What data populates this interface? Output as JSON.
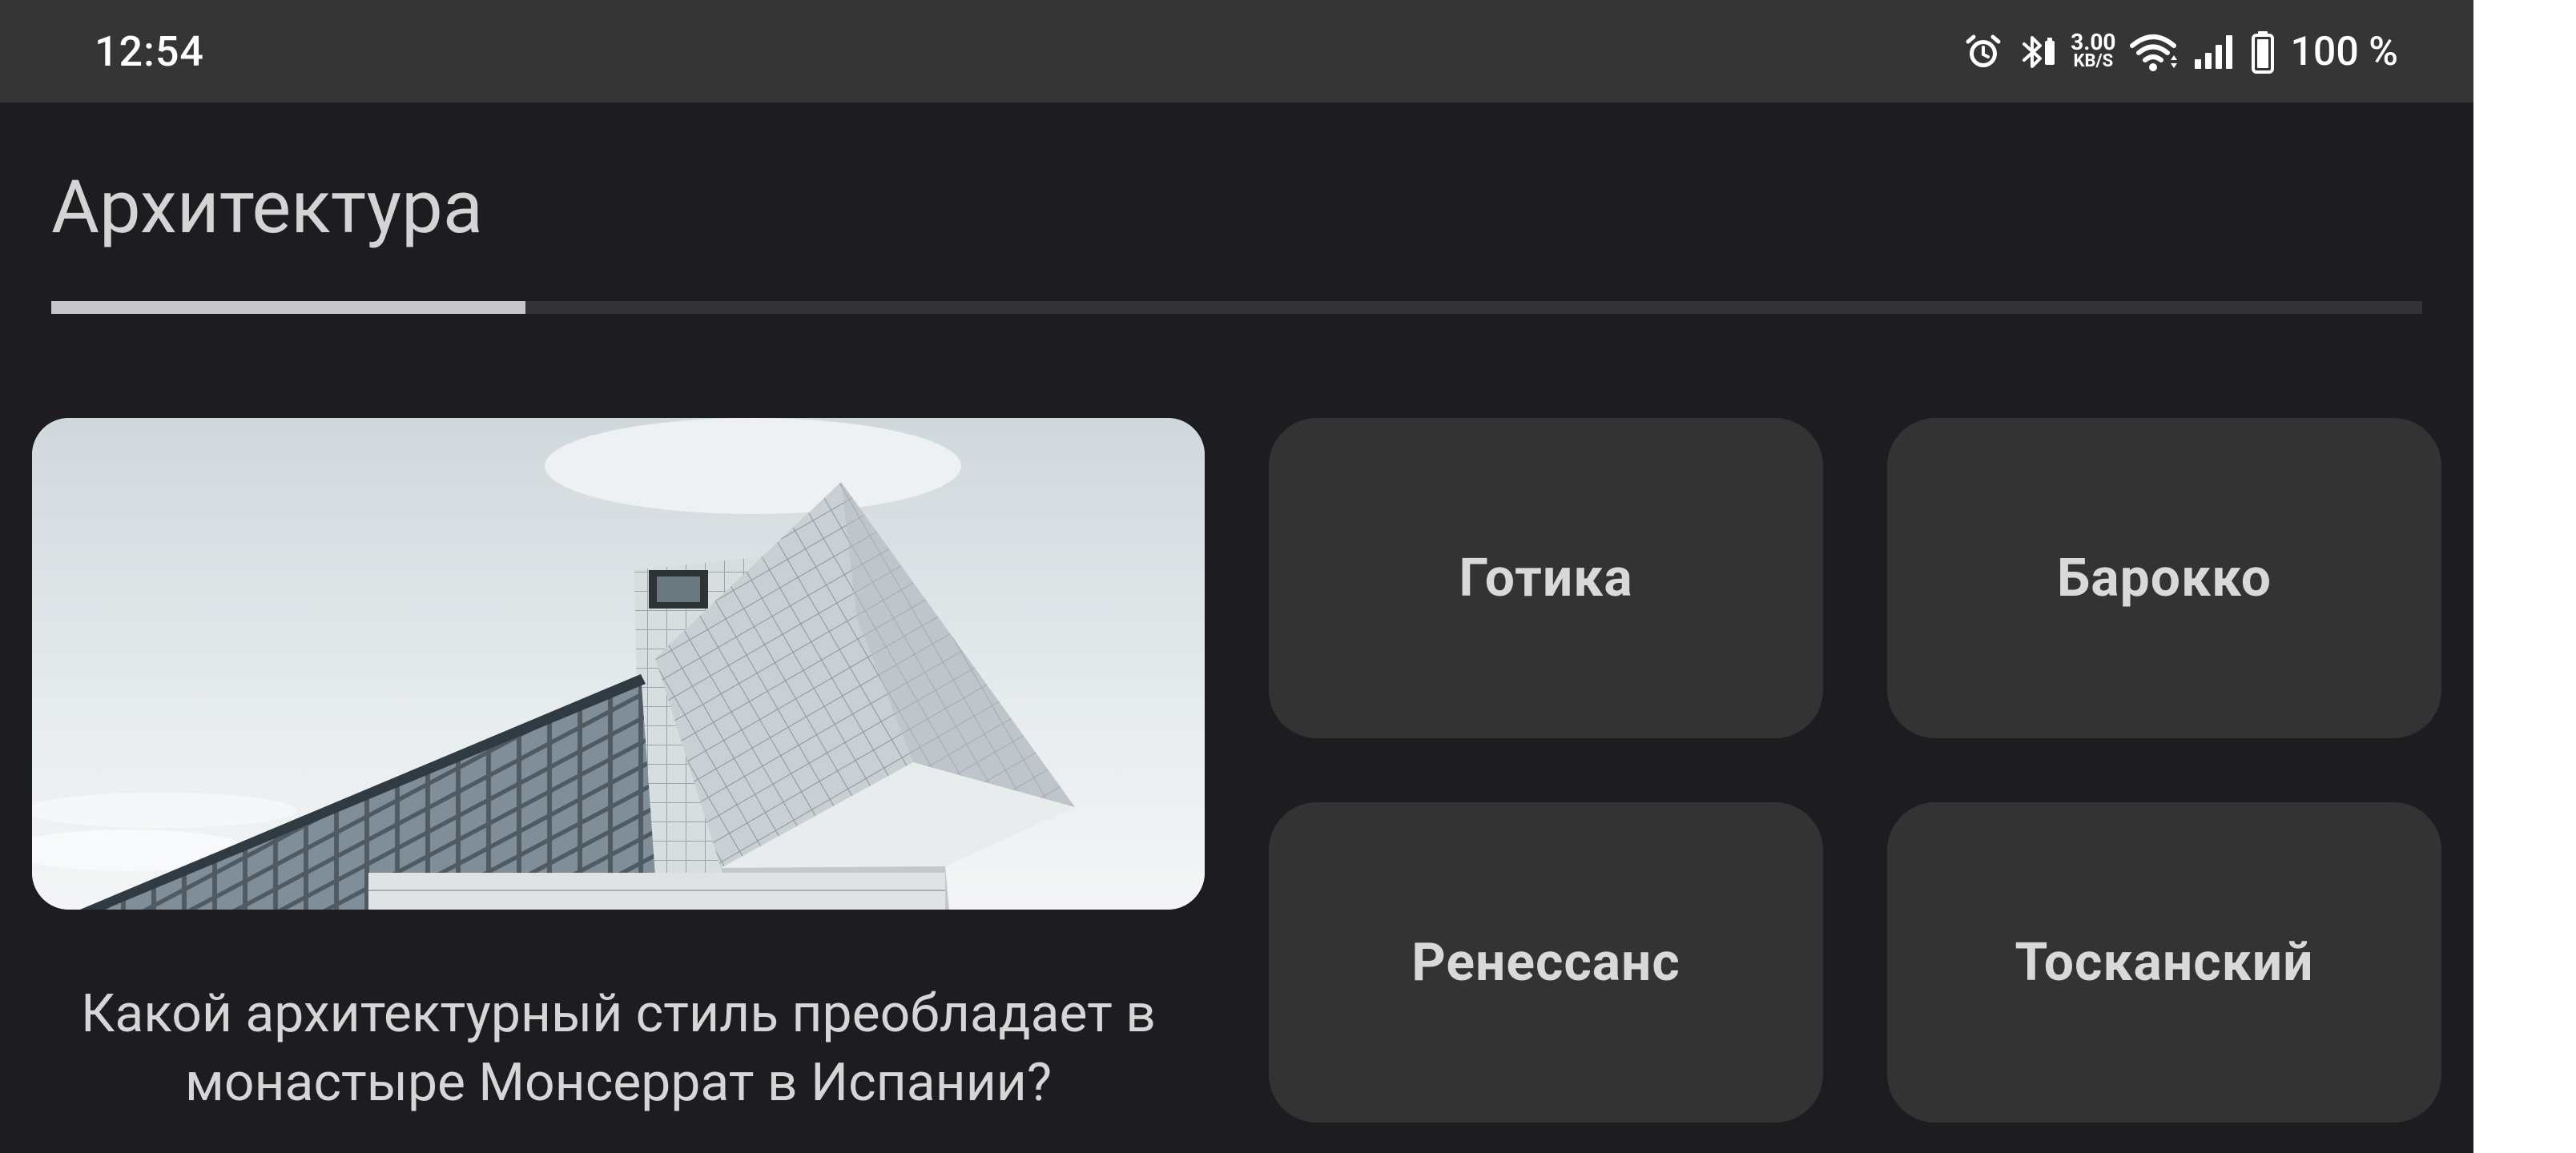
{
  "status_bar": {
    "time": "12:54",
    "net_speed_value": "3.00",
    "net_speed_unit": "KB/S",
    "battery": "100 %",
    "icons": [
      "alarm-icon",
      "bluetooth-icon",
      "wifi-icon",
      "signal-icon",
      "battery-icon"
    ]
  },
  "quiz": {
    "category_title": "Архитектура",
    "progress_fraction": 0.2,
    "question": "Какой архитектурный стиль преобладает в монастыре Монсеррат в Испании?",
    "image_subject": "modern-glass-building-photo",
    "answers": [
      {
        "label": "Готика"
      },
      {
        "label": "Барокко"
      },
      {
        "label": "Ренессанс"
      },
      {
        "label": "Тосканский"
      }
    ]
  },
  "colors": {
    "background": "#1d1c20",
    "status_bar": "#353535",
    "button": "#333333",
    "progress_fill": "#c8c8c8",
    "progress_track": "#333236"
  }
}
